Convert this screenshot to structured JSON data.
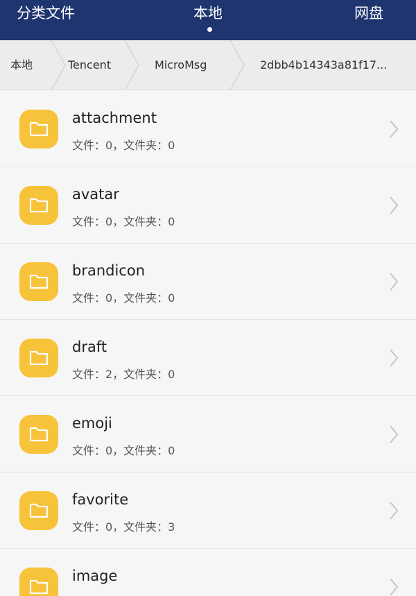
{
  "top_tabs": [
    {
      "label": "分类文件"
    },
    {
      "label": "本地"
    },
    {
      "label": "网盘"
    }
  ],
  "breadcrumbs": [
    {
      "label": "本地"
    },
    {
      "label": "Tencent"
    },
    {
      "label": "MicroMsg"
    },
    {
      "label": "2dbb4b14343a81f17..."
    }
  ],
  "folders": [
    {
      "name": "attachment",
      "meta": "文件：0，文件夹：0"
    },
    {
      "name": "avatar",
      "meta": "文件：0，文件夹：0"
    },
    {
      "name": "brandicon",
      "meta": "文件：0，文件夹：0"
    },
    {
      "name": "draft",
      "meta": "文件：2，文件夹：0"
    },
    {
      "name": "emoji",
      "meta": "文件：0，文件夹：0"
    },
    {
      "name": "favorite",
      "meta": "文件：0，文件夹：3"
    },
    {
      "name": "image",
      "meta": ""
    }
  ],
  "colors": {
    "topbar": "#1f3570",
    "folder": "#f6c33b",
    "background": "#f4f4f4"
  },
  "icons": {
    "folder": "folder-icon",
    "row_arrow": "chevron-right-icon",
    "breadcrumb_separator": "chevron-right-icon"
  }
}
